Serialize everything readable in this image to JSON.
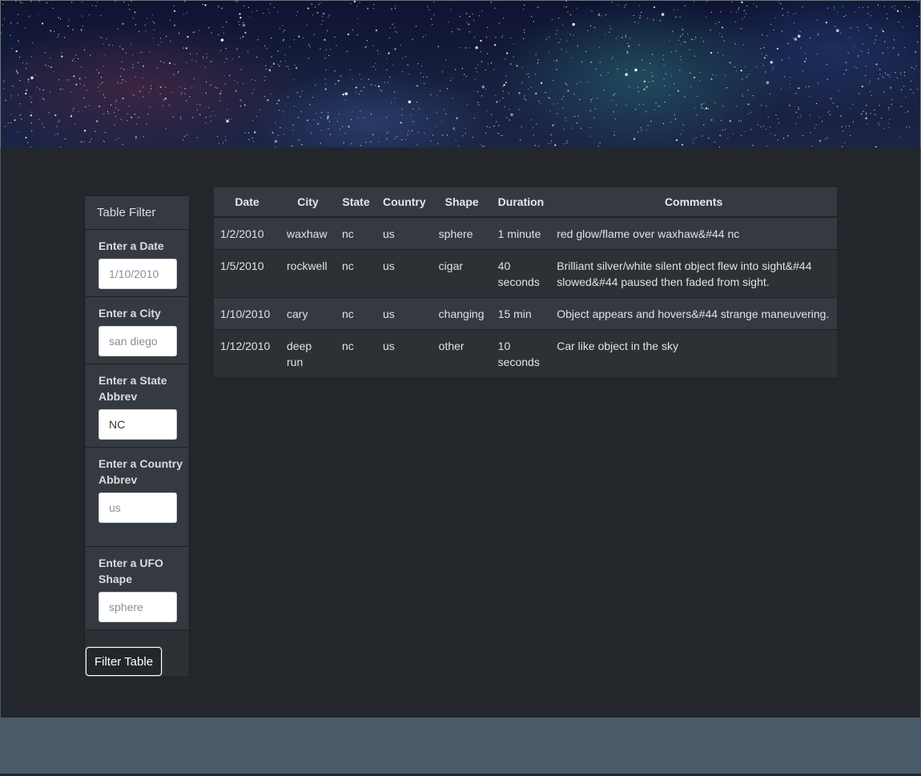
{
  "filter": {
    "title": "Table Filter",
    "fields": [
      {
        "label": "Enter a Date",
        "placeholder": "1/10/2010",
        "value": ""
      },
      {
        "label": "Enter a City",
        "placeholder": "san diego",
        "value": ""
      },
      {
        "label": "Enter a State Abbrev",
        "placeholder": "",
        "value": "NC"
      },
      {
        "label": "Enter a Country Abbrev",
        "placeholder": "us",
        "value": ""
      },
      {
        "label": "Enter a UFO Shape",
        "placeholder": "sphere",
        "value": ""
      }
    ],
    "button_label": "Filter Table"
  },
  "table": {
    "headers": [
      "Date",
      "City",
      "State",
      "Country",
      "Shape",
      "Duration",
      "Comments"
    ],
    "rows": [
      [
        "1/2/2010",
        "waxhaw",
        "nc",
        "us",
        "sphere",
        "1 minute",
        "red glow/flame over waxhaw&#44 nc"
      ],
      [
        "1/5/2010",
        "rockwell",
        "nc",
        "us",
        "cigar",
        "40 seconds",
        "Brilliant silver/white silent object flew into sight&#44 slowed&#44 paused then faded from sight."
      ],
      [
        "1/10/2010",
        "cary",
        "nc",
        "us",
        "changing",
        "15 min",
        "Object appears and hovers&#44 strange maneuvering."
      ],
      [
        "1/12/2010",
        "deep run",
        "nc",
        "us",
        "other",
        "10 seconds",
        "Car like object in the sky"
      ]
    ]
  },
  "colors": {
    "page_background": "#23272b",
    "footer": "#4b5a68",
    "panel": "#343a40"
  }
}
